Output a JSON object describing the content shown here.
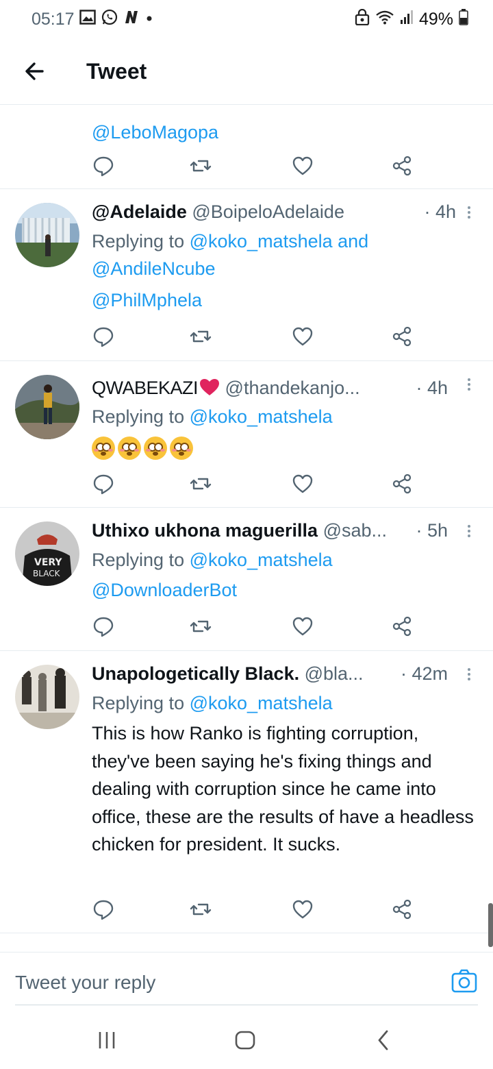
{
  "status": {
    "time": "05:17",
    "battery": "49%",
    "icons_left": [
      "image-icon",
      "whatsapp-icon",
      "n-app-icon",
      "dot-icon"
    ],
    "icons_right": [
      "lock-icon",
      "wifi-icon",
      "signal-icon",
      "battery-icon"
    ]
  },
  "header": {
    "title": "Tweet"
  },
  "tweets": [
    {
      "mention": "@LeboMagopa"
    },
    {
      "name": "@Adelaide",
      "handle": "@BoipeloAdelaide",
      "time": "· 4h",
      "reply_prefix": "Replying to",
      "reply_to": "@koko_matshela and",
      "reply_to2": "@AndileNcube",
      "body": "@PhilMphela"
    },
    {
      "name": "QWABEKAZI",
      "handle": "@thandekanjo...",
      "time": "· 4h",
      "reply_prefix": "Replying to",
      "reply_to": "@koko_matshela",
      "emoji_count": 4
    },
    {
      "name": "Uthixo ukhona maguerilla",
      "handle": "@sab...",
      "time": "· 5h",
      "reply_prefix": "Replying to",
      "reply_to": "@koko_matshela",
      "body": "@DownloaderBot"
    },
    {
      "name": "Unapologetically Black.",
      "handle": "@bla...",
      "time": "· 42m",
      "reply_prefix": "Replying to",
      "reply_to": "@koko_matshela",
      "body": "This is how Ranko is fighting corruption, they've been saying he's fixing things and dealing with corruption since he came into office, these are the results of have a headless chicken for president. It sucks."
    }
  ],
  "composer": {
    "placeholder": "Tweet your reply"
  },
  "colors": {
    "accent": "#1d9bf0",
    "text": "#0f1419",
    "muted": "#536471"
  }
}
